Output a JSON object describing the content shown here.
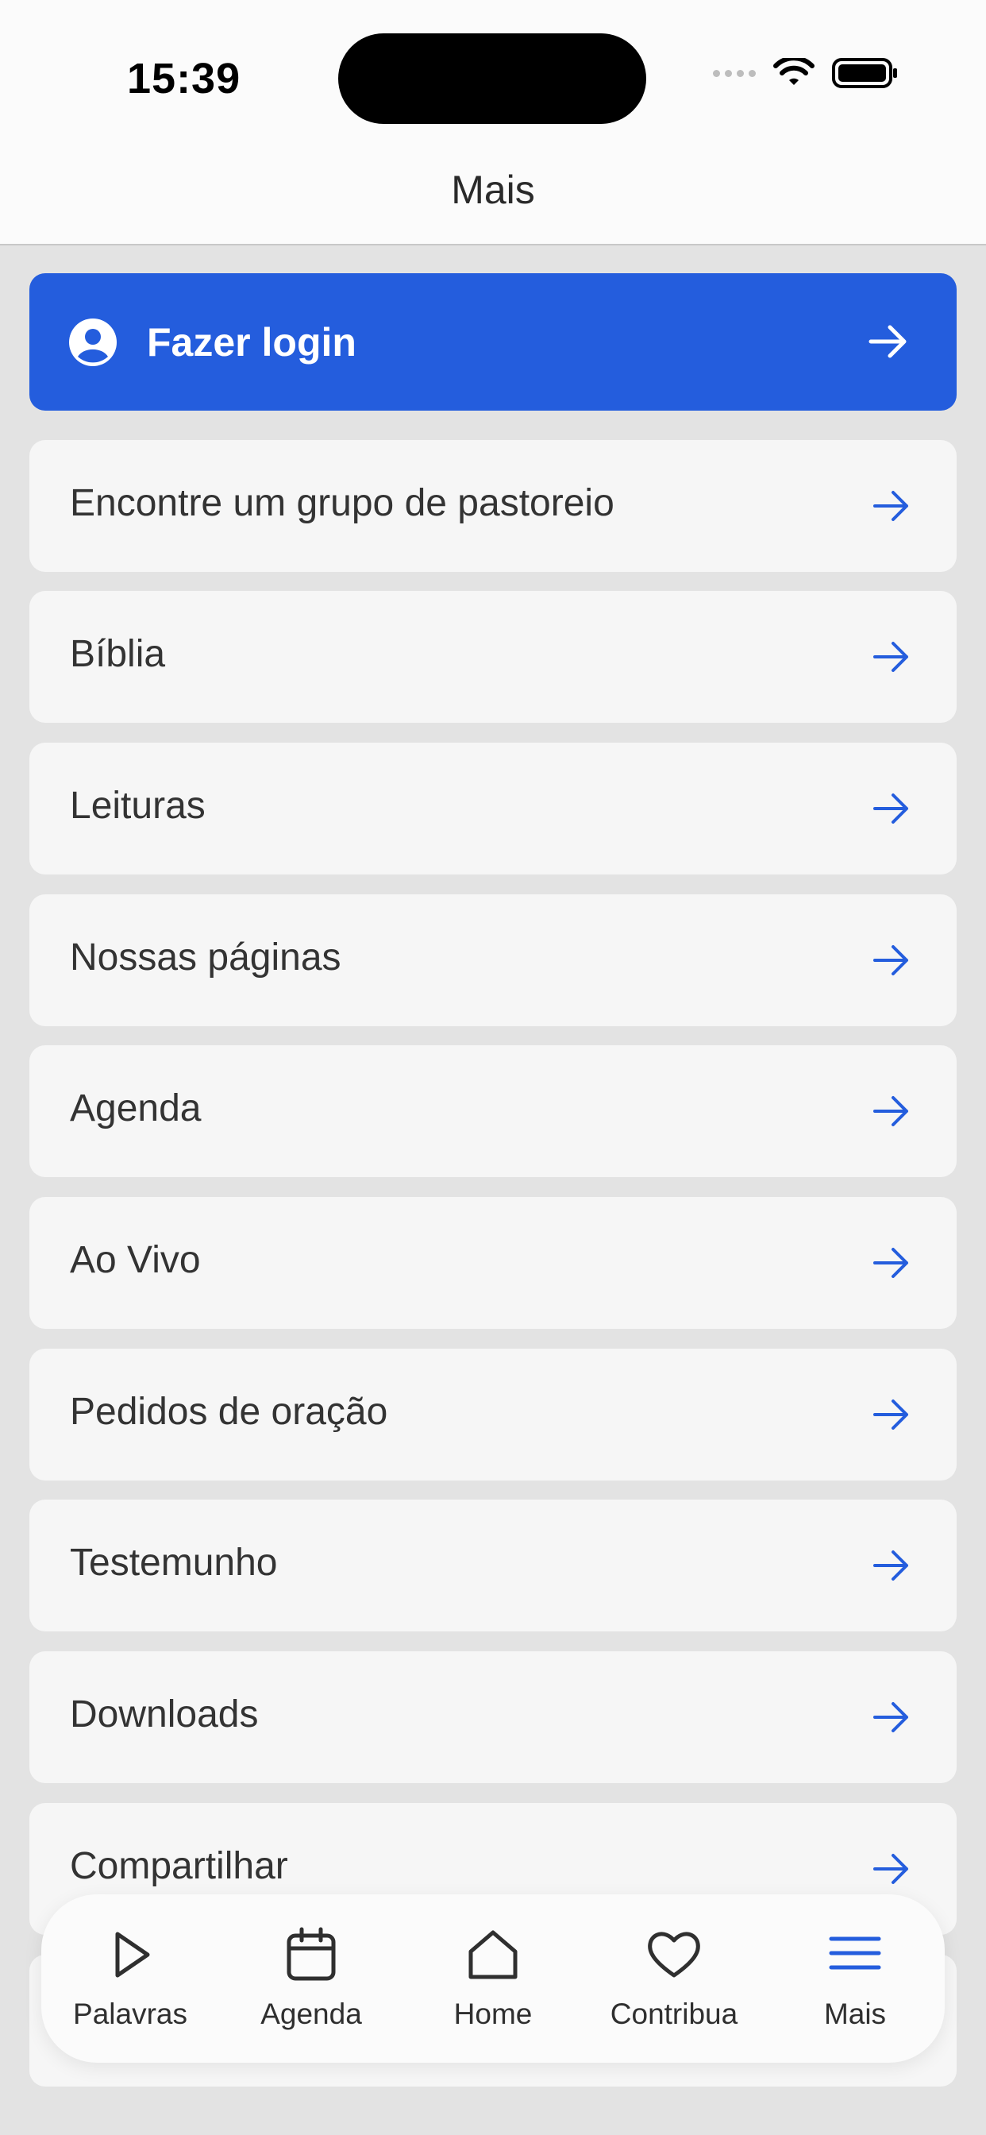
{
  "status_bar": {
    "time": "15:39"
  },
  "nav": {
    "title": "Mais"
  },
  "login": {
    "label": "Fazer login",
    "icon": "user-circle-icon",
    "arrow_icon": "arrow-right-icon"
  },
  "menu": {
    "items": [
      {
        "label": "Encontre um grupo de pastoreio"
      },
      {
        "label": "Bíblia"
      },
      {
        "label": "Leituras"
      },
      {
        "label": "Nossas páginas"
      },
      {
        "label": "Agenda"
      },
      {
        "label": "Ao Vivo"
      },
      {
        "label": "Pedidos de oração"
      },
      {
        "label": "Testemunho"
      },
      {
        "label": "Downloads"
      },
      {
        "label": "Compartilhar"
      },
      {
        "label": ""
      }
    ]
  },
  "tabbar": {
    "tabs": [
      {
        "label": "Palavras",
        "icon": "play-icon"
      },
      {
        "label": "Agenda",
        "icon": "calendar-icon"
      },
      {
        "label": "Home",
        "icon": "home-icon"
      },
      {
        "label": "Contribua",
        "icon": "heart-icon"
      },
      {
        "label": "Mais",
        "icon": "menu-icon",
        "active": true
      }
    ]
  },
  "colors": {
    "accent": "#245ddd",
    "background": "#e3e3e3",
    "card": "#f6f6f6"
  }
}
